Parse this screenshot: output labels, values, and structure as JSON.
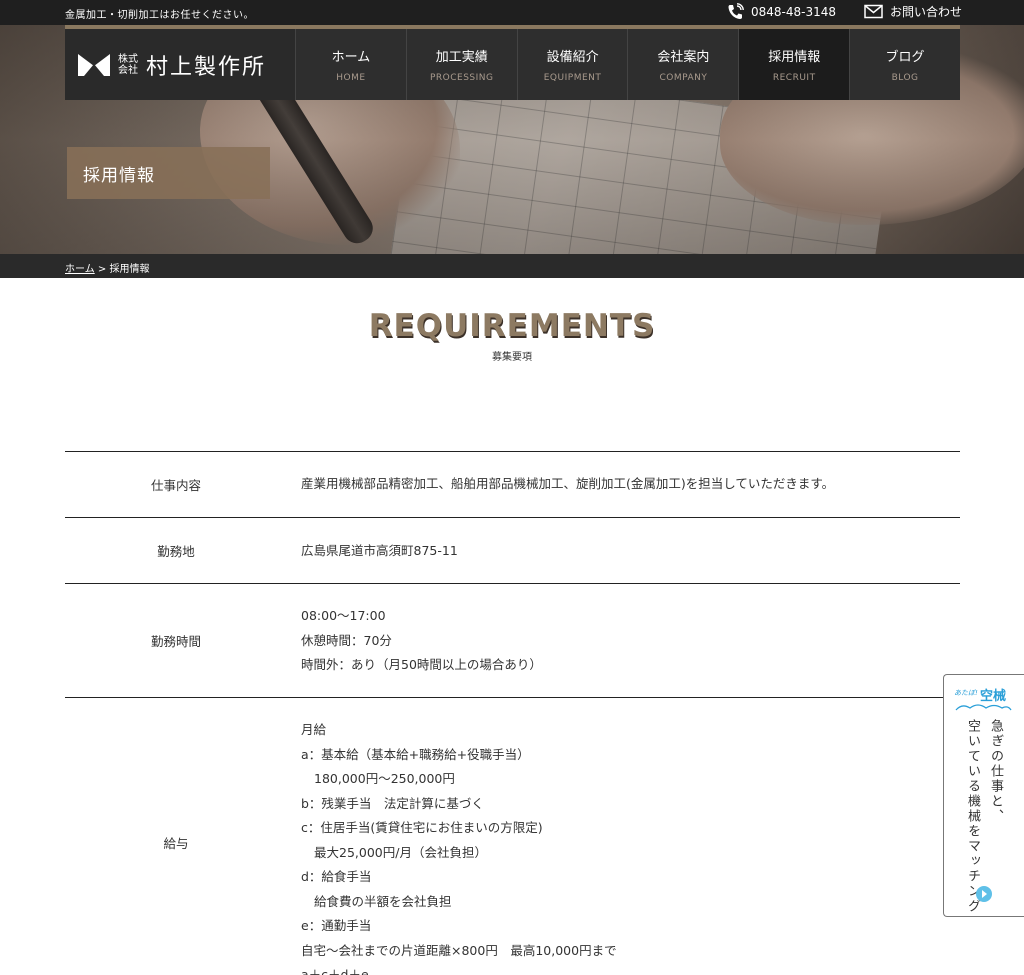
{
  "topbar": {
    "tagline": "金属加工・切削加工はお任せください。",
    "phone": "0848-48-3148",
    "contact": "お問い合わせ"
  },
  "logo": {
    "kabushiki_1": "株式",
    "kabushiki_2": "会社",
    "name": "村上製作所"
  },
  "nav": [
    {
      "jp": "ホーム",
      "en": "HOME"
    },
    {
      "jp": "加工実績",
      "en": "PROCESSING"
    },
    {
      "jp": "設備紹介",
      "en": "EQUIPMENT"
    },
    {
      "jp": "会社案内",
      "en": "COMPANY"
    },
    {
      "jp": "採用情報",
      "en": "RECRUIT"
    },
    {
      "jp": "ブログ",
      "en": "BLOG"
    }
  ],
  "page_title": "採用情報",
  "breadcrumb": {
    "home": "ホーム",
    "separator": ">",
    "current": "採用情報"
  },
  "section": {
    "title": "REQUIREMENTS",
    "subtitle": "募集要項"
  },
  "requirements": [
    {
      "label": "仕事内容",
      "lines": [
        "産業用機械部品精密加工、船舶用部品機械加工、旋削加工(金属加工)を担当していただきます。"
      ]
    },
    {
      "label": "勤務地",
      "lines": [
        "広島県尾道市高須町875-11"
      ]
    },
    {
      "label": "勤務時間",
      "lines": [
        "08:00〜17:00",
        "休憩時間：70分",
        "時間外：あり（月50時間以上の場合あり）"
      ]
    },
    {
      "label": "給与",
      "lines": [
        "月給",
        "a：基本給（基本給+職務給+役職手当）",
        "180,000円〜250,000円",
        "b：残業手当　法定計算に基づく",
        "c：住居手当(賃貸住宅にお住まいの方限定)",
        "最大25,000円/月（会社負担）",
        "d：給食手当",
        "給食費の半額を会社負担",
        "e：通勤手当",
        "自宅〜会社までの片道距離×800円　最高10,000円まで",
        "a＋c＋d＋e"
      ]
    }
  ],
  "side_banner": {
    "brand_small": "あたぼ!",
    "brand_main": "空械",
    "text_1": "急ぎの仕事と、",
    "text_2": "空いている機械をマッチング"
  }
}
